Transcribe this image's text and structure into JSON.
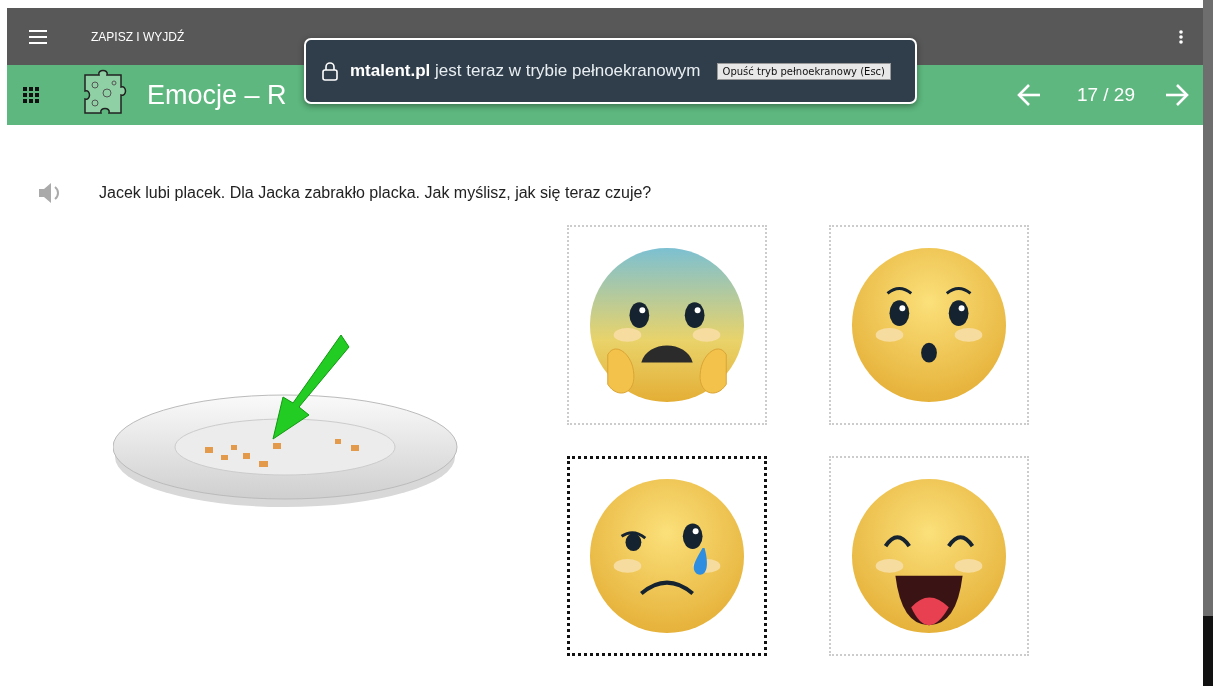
{
  "top_bar": {
    "save_exit": "ZAPISZ I WYJDŹ"
  },
  "header": {
    "title": "Emocje – R",
    "page": "17 / 29"
  },
  "fullscreen_notice": {
    "domain": "mtalent.pl",
    "message": "jest teraz w trybie pełnoekranowym",
    "exit_button": "Opuść tryb pełnoekranowy (Esc)"
  },
  "question": {
    "text": "Jacek lubi placek. Dla Jacka zabrakło placka. Jak myślisz, jak się teraz czuje?"
  },
  "answers": [
    {
      "kind": "scared",
      "selected": false
    },
    {
      "kind": "surprised",
      "selected": false
    },
    {
      "kind": "sad",
      "selected": true
    },
    {
      "kind": "laughing",
      "selected": false
    }
  ]
}
